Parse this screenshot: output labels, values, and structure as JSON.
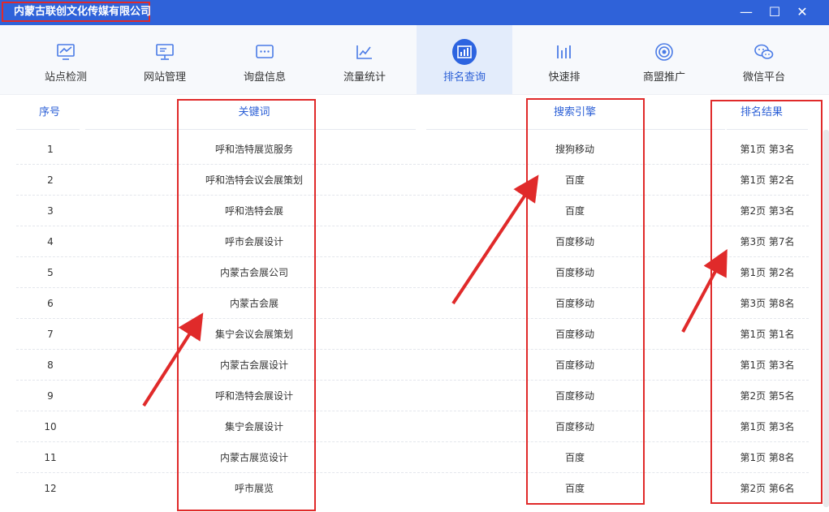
{
  "window": {
    "title": "内蒙古联创文化传媒有限公司",
    "controls": {
      "minimize": "—",
      "maximize": "☐",
      "close": "✕"
    }
  },
  "toolbar": [
    {
      "label": "站点检测",
      "icon": "monitor-chart-icon"
    },
    {
      "label": "网站管理",
      "icon": "desktop-icon"
    },
    {
      "label": "询盘信息",
      "icon": "message-dots-icon"
    },
    {
      "label": "流量统计",
      "icon": "line-chart-icon"
    },
    {
      "label": "排名查询",
      "icon": "bar-chart-icon",
      "active": true
    },
    {
      "label": "快速排",
      "icon": "bars-icon"
    },
    {
      "label": "商盟推广",
      "icon": "target-icon"
    },
    {
      "label": "微信平台",
      "icon": "wechat-icon"
    }
  ],
  "table": {
    "headers": {
      "index": "序号",
      "keyword": "关键词",
      "engine": "搜索引擎",
      "result": "排名结果"
    },
    "rows": [
      {
        "index": "1",
        "keyword": "呼和浩特展览服务",
        "engine": "搜狗移动",
        "result": "第1页 第3名"
      },
      {
        "index": "2",
        "keyword": "呼和浩特会议会展策划",
        "engine": "百度",
        "result": "第1页 第2名"
      },
      {
        "index": "3",
        "keyword": "呼和浩特会展",
        "engine": "百度",
        "result": "第2页 第3名"
      },
      {
        "index": "4",
        "keyword": "呼市会展设计",
        "engine": "百度移动",
        "result": "第3页 第7名"
      },
      {
        "index": "5",
        "keyword": "内蒙古会展公司",
        "engine": "百度移动",
        "result": "第1页 第2名"
      },
      {
        "index": "6",
        "keyword": "内蒙古会展",
        "engine": "百度移动",
        "result": "第3页 第8名"
      },
      {
        "index": "7",
        "keyword": "集宁会议会展策划",
        "engine": "百度移动",
        "result": "第1页 第1名"
      },
      {
        "index": "8",
        "keyword": "内蒙古会展设计",
        "engine": "百度移动",
        "result": "第1页 第3名"
      },
      {
        "index": "9",
        "keyword": "呼和浩特会展设计",
        "engine": "百度移动",
        "result": "第2页 第5名"
      },
      {
        "index": "10",
        "keyword": "集宁会展设计",
        "engine": "百度移动",
        "result": "第1页 第3名"
      },
      {
        "index": "11",
        "keyword": "内蒙古展览设计",
        "engine": "百度",
        "result": "第1页 第8名"
      },
      {
        "index": "12",
        "keyword": "呼市展览",
        "engine": "百度",
        "result": "第2页 第6名"
      }
    ]
  },
  "colors": {
    "titlebar": "#2f62d9",
    "accent": "#2b5fd6",
    "annotation": "#e02a2a"
  }
}
